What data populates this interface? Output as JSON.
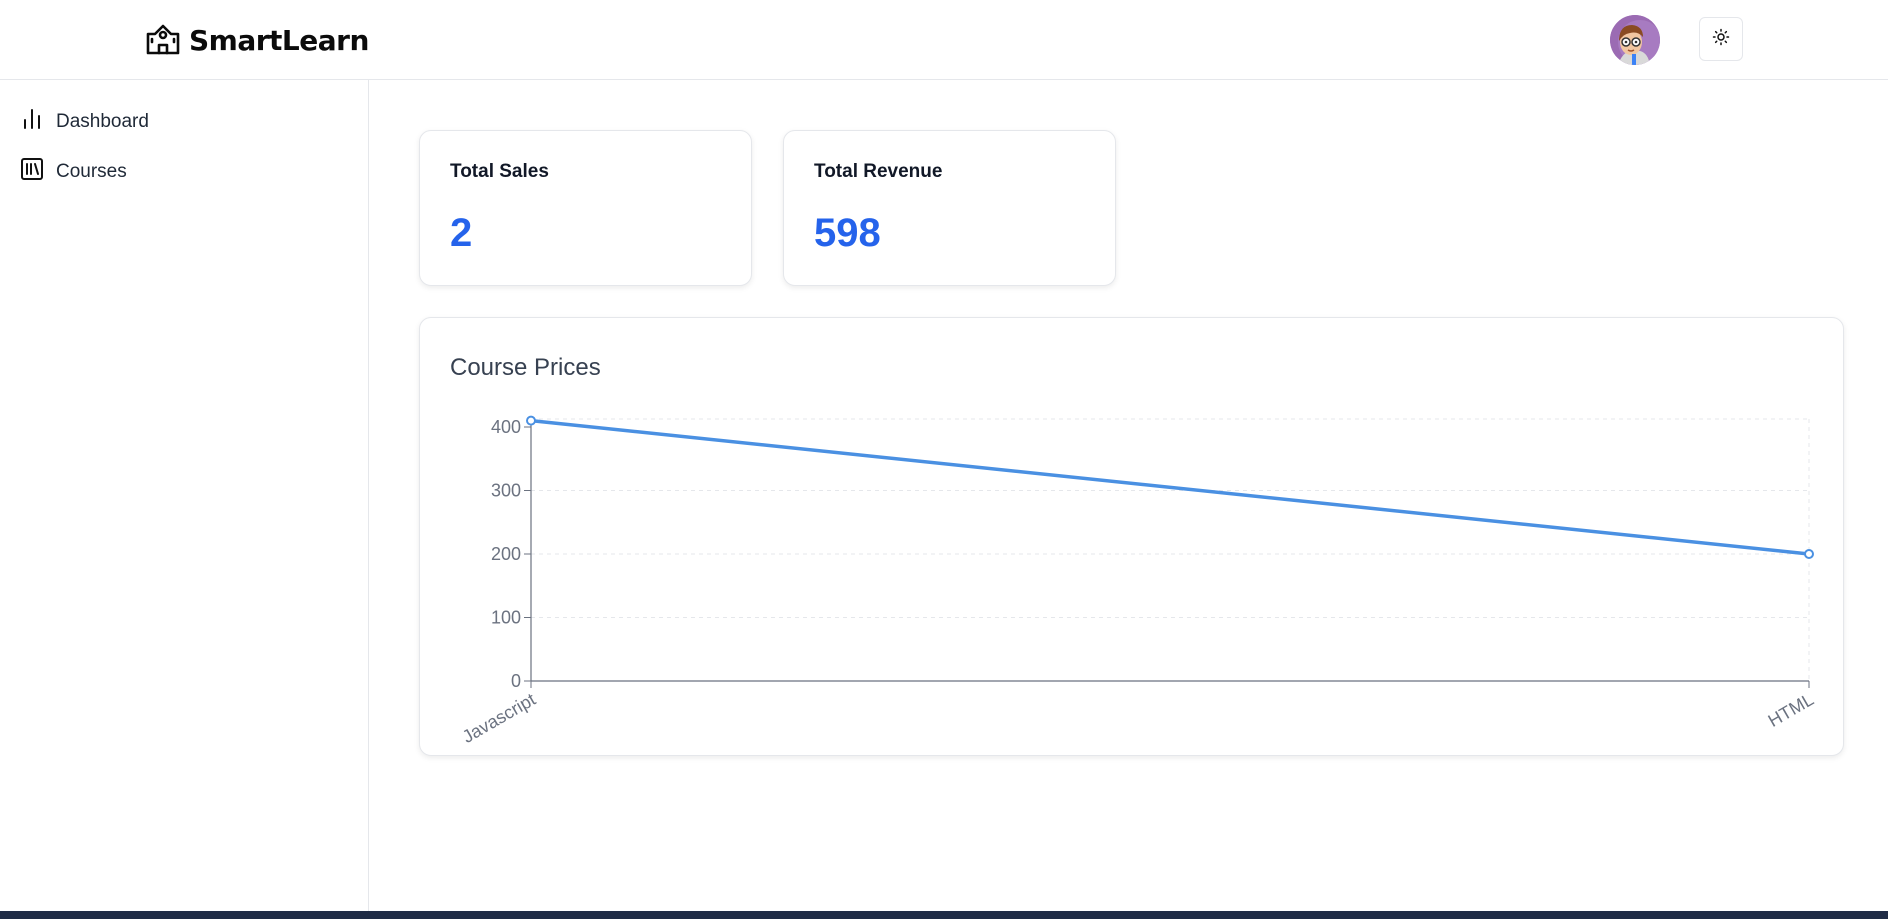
{
  "app": {
    "name": "SmartLearn"
  },
  "header": {
    "avatar_icon": "user-avatar",
    "theme_icon": "sun-icon"
  },
  "sidebar": {
    "items": [
      {
        "label": "Dashboard",
        "icon": "bar-chart-icon"
      },
      {
        "label": "Courses",
        "icon": "library-icon"
      }
    ]
  },
  "stats": [
    {
      "title": "Total Sales",
      "value": "2"
    },
    {
      "title": "Total Revenue",
      "value": "598"
    }
  ],
  "colors": {
    "accent": "#2563eb",
    "line": "#4a90e2"
  },
  "chart_data": {
    "type": "line",
    "title": "Course Prices",
    "categories": [
      "Javascript",
      "HTML"
    ],
    "values": [
      410,
      200
    ],
    "ylim": [
      0,
      400
    ],
    "yticks": [
      "0",
      "100",
      "200",
      "300",
      "400"
    ],
    "grid": true
  }
}
